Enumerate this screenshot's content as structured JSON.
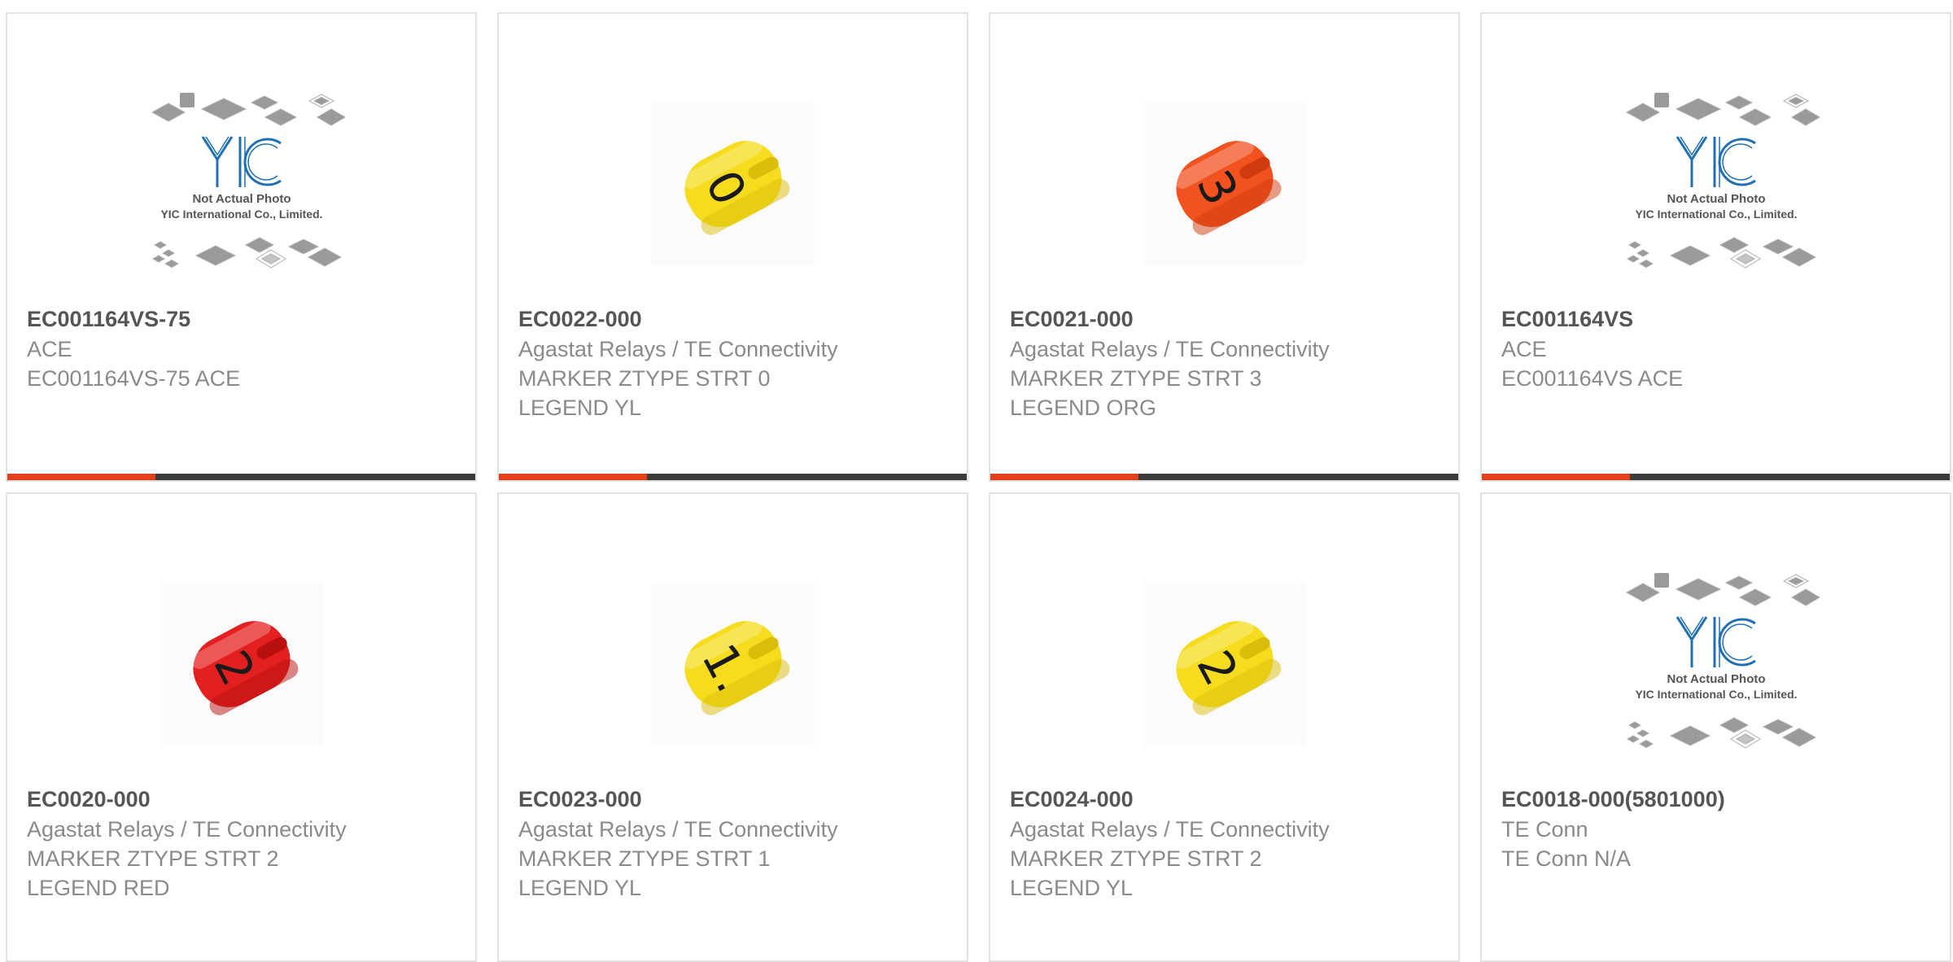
{
  "colors": {
    "accent": "#e2411a",
    "bar": "#3b3b3b",
    "border": "#e2e2e2",
    "part_number": "#555555",
    "text": "#8a8a8a",
    "yic_blue": "#1f6fb5"
  },
  "placeholder": {
    "line1": "Not Actual Photo",
    "line2": "YIC International Co., Limited."
  },
  "products": [
    {
      "part_number": "EC001164VS-75",
      "manufacturer": "ACE",
      "desc1": "EC001164VS-75 ACE",
      "desc2": "",
      "image": "not-actual-photo-placeholder"
    },
    {
      "part_number": "EC0022-000",
      "manufacturer": "Agastat Relays / TE Connectivity",
      "desc1": "MARKER ZTYPE STRT 0",
      "desc2": "LEGEND YL",
      "image": "yellow-cable-marker-0"
    },
    {
      "part_number": "EC0021-000",
      "manufacturer": "Agastat Relays / TE Connectivity",
      "desc1": "MARKER ZTYPE STRT 3",
      "desc2": "LEGEND ORG",
      "image": "orange-cable-marker-3"
    },
    {
      "part_number": "EC001164VS",
      "manufacturer": "ACE",
      "desc1": "EC001164VS ACE",
      "desc2": "",
      "image": "not-actual-photo-placeholder"
    },
    {
      "part_number": "EC0020-000",
      "manufacturer": "Agastat Relays / TE Connectivity",
      "desc1": "MARKER ZTYPE STRT 2",
      "desc2": "LEGEND RED",
      "image": "red-cable-marker-2"
    },
    {
      "part_number": "EC0023-000",
      "manufacturer": "Agastat Relays / TE Connectivity",
      "desc1": "MARKER ZTYPE STRT 1",
      "desc2": "LEGEND YL",
      "image": "yellow-cable-marker-1"
    },
    {
      "part_number": "EC0024-000",
      "manufacturer": "Agastat Relays / TE Connectivity",
      "desc1": "MARKER ZTYPE STRT 2",
      "desc2": "LEGEND YL",
      "image": "yellow-cable-marker-2"
    },
    {
      "part_number": "EC0018-000(5801000)",
      "manufacturer": "TE Conn",
      "desc1": "TE Conn N/A",
      "desc2": "",
      "image": "not-actual-photo-placeholder"
    }
  ],
  "markers": {
    "yellow-cable-marker-0": {
      "color": "#f5dc1e",
      "shade": "#d9bd0a",
      "digit": "0"
    },
    "orange-cable-marker-3": {
      "color": "#f2521f",
      "shade": "#cf3b0e",
      "digit": "3"
    },
    "red-cable-marker-2": {
      "color": "#e3201f",
      "shade": "#b8100f",
      "digit": "2"
    },
    "yellow-cable-marker-1": {
      "color": "#f5dc1e",
      "shade": "#d9bd0a",
      "digit": "1."
    },
    "yellow-cable-marker-2": {
      "color": "#f5dc1e",
      "shade": "#d9bd0a",
      "digit": "2"
    }
  }
}
